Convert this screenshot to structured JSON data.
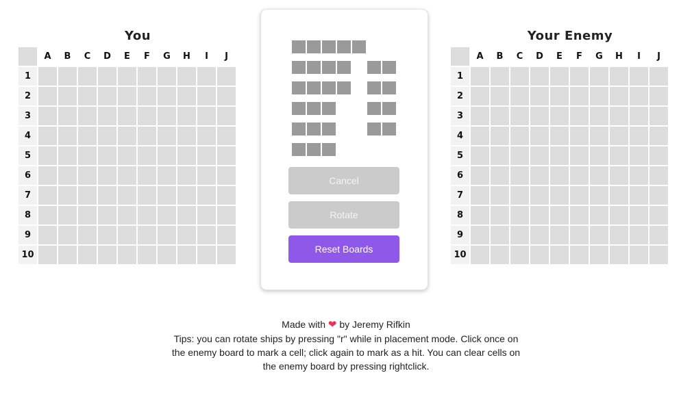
{
  "boards": {
    "player": {
      "title": "You"
    },
    "enemy": {
      "title": "Your Enemy"
    },
    "columns": [
      "A",
      "B",
      "C",
      "D",
      "E",
      "F",
      "G",
      "H",
      "I",
      "J"
    ],
    "rows": [
      "1",
      "2",
      "3",
      "4",
      "5",
      "6",
      "7",
      "8",
      "9",
      "10"
    ]
  },
  "ship_tray": {
    "ships": [
      {
        "id": "carrier",
        "length": 5
      },
      {
        "id": "battleship-1",
        "length": 4
      },
      {
        "id": "battleship-2",
        "length": 4
      },
      {
        "id": "cruiser-1",
        "length": 3
      },
      {
        "id": "cruiser-2",
        "length": 3
      },
      {
        "id": "cruiser-3",
        "length": 3
      },
      {
        "id": "destroyer-1",
        "length": 2
      },
      {
        "id": "destroyer-2",
        "length": 2
      },
      {
        "id": "destroyer-3",
        "length": 2
      },
      {
        "id": "destroyer-4",
        "length": 2
      }
    ]
  },
  "buttons": {
    "cancel": "Cancel",
    "rotate": "Rotate",
    "reset": "Reset Boards"
  },
  "footer": {
    "made_with": "Made with",
    "heart_icon": "heart-icon",
    "heart_glyph": "❤",
    "by": "by Jeremy Rifkin",
    "tips": "Tips: you can rotate ships by pressing \"r\" while in placement mode. Click once on the enemy board to mark a cell; click again to mark as a hit. You can clear cells on the enemy board by pressing rightclick."
  },
  "colors": {
    "cell": "#dddddd",
    "ship": "#9a9a9a",
    "disabled_button": "#cbcbcb",
    "accent": "#8f58e8",
    "heart": "#e8325a"
  }
}
